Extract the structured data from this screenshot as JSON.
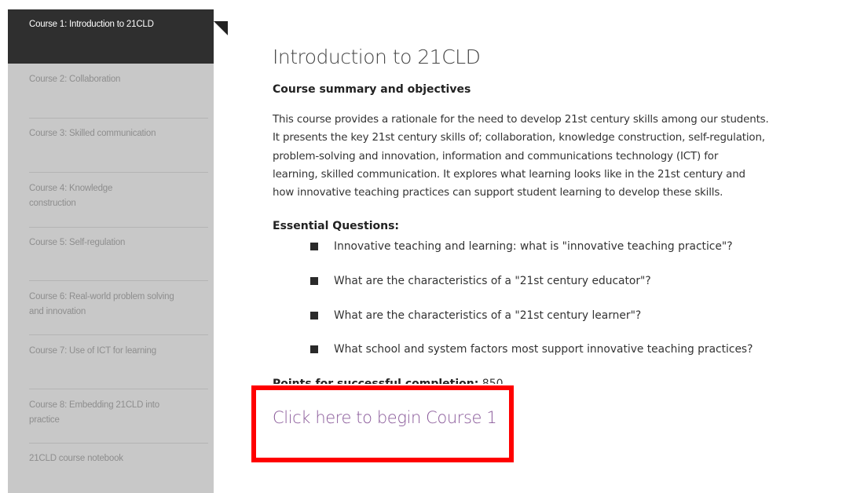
{
  "sidebar": {
    "items": [
      {
        "label": "Course 1: Introduction to 21CLD",
        "active": true
      },
      {
        "label": "Course 2: Collaboration"
      },
      {
        "label": "Course 3: Skilled communication"
      },
      {
        "label": "Course 4: Knowledge construction"
      },
      {
        "label": "Course 5: Self-regulation"
      },
      {
        "label": "Course 6: Real-world problem solving and innovation"
      },
      {
        "label": "Course 7: Use of ICT for learning"
      },
      {
        "label": "Course 8: Embedding 21CLD into practice"
      },
      {
        "label": "21CLD course notebook"
      }
    ]
  },
  "main": {
    "title": "Introduction to 21CLD",
    "summary_heading": "Course summary and objectives",
    "summary_lines": [
      "This course provides a rationale for the need to develop 21st century skills among our students.",
      "It presents the key 21st century skills of; collaboration, knowledge construction, self-regulation,",
      "problem-solving and innovation, information and communications technology (ICT) for",
      "learning, skilled communication. It explores what learning looks like in the 21st century and",
      "how innovative teaching practices can support student learning to develop these skills."
    ],
    "questions_heading": "Essential Questions:",
    "questions": [
      "Innovative teaching and learning: what is \"innovative teaching practice\"?",
      "What are the characteristics of a \"21st century educator\"?",
      "What are the characteristics of a \"21st century learner\"?",
      "What school and system factors most support innovative teaching practices?"
    ],
    "points_label": "Points for successful completion:",
    "points_value": "850",
    "begin_link": "Click here to begin Course 1"
  },
  "colors": {
    "sidebar_bg": "#c8c8c8",
    "active_bg": "#2f2f2f",
    "link": "#8a5a9a",
    "highlight": "#ff0000"
  }
}
